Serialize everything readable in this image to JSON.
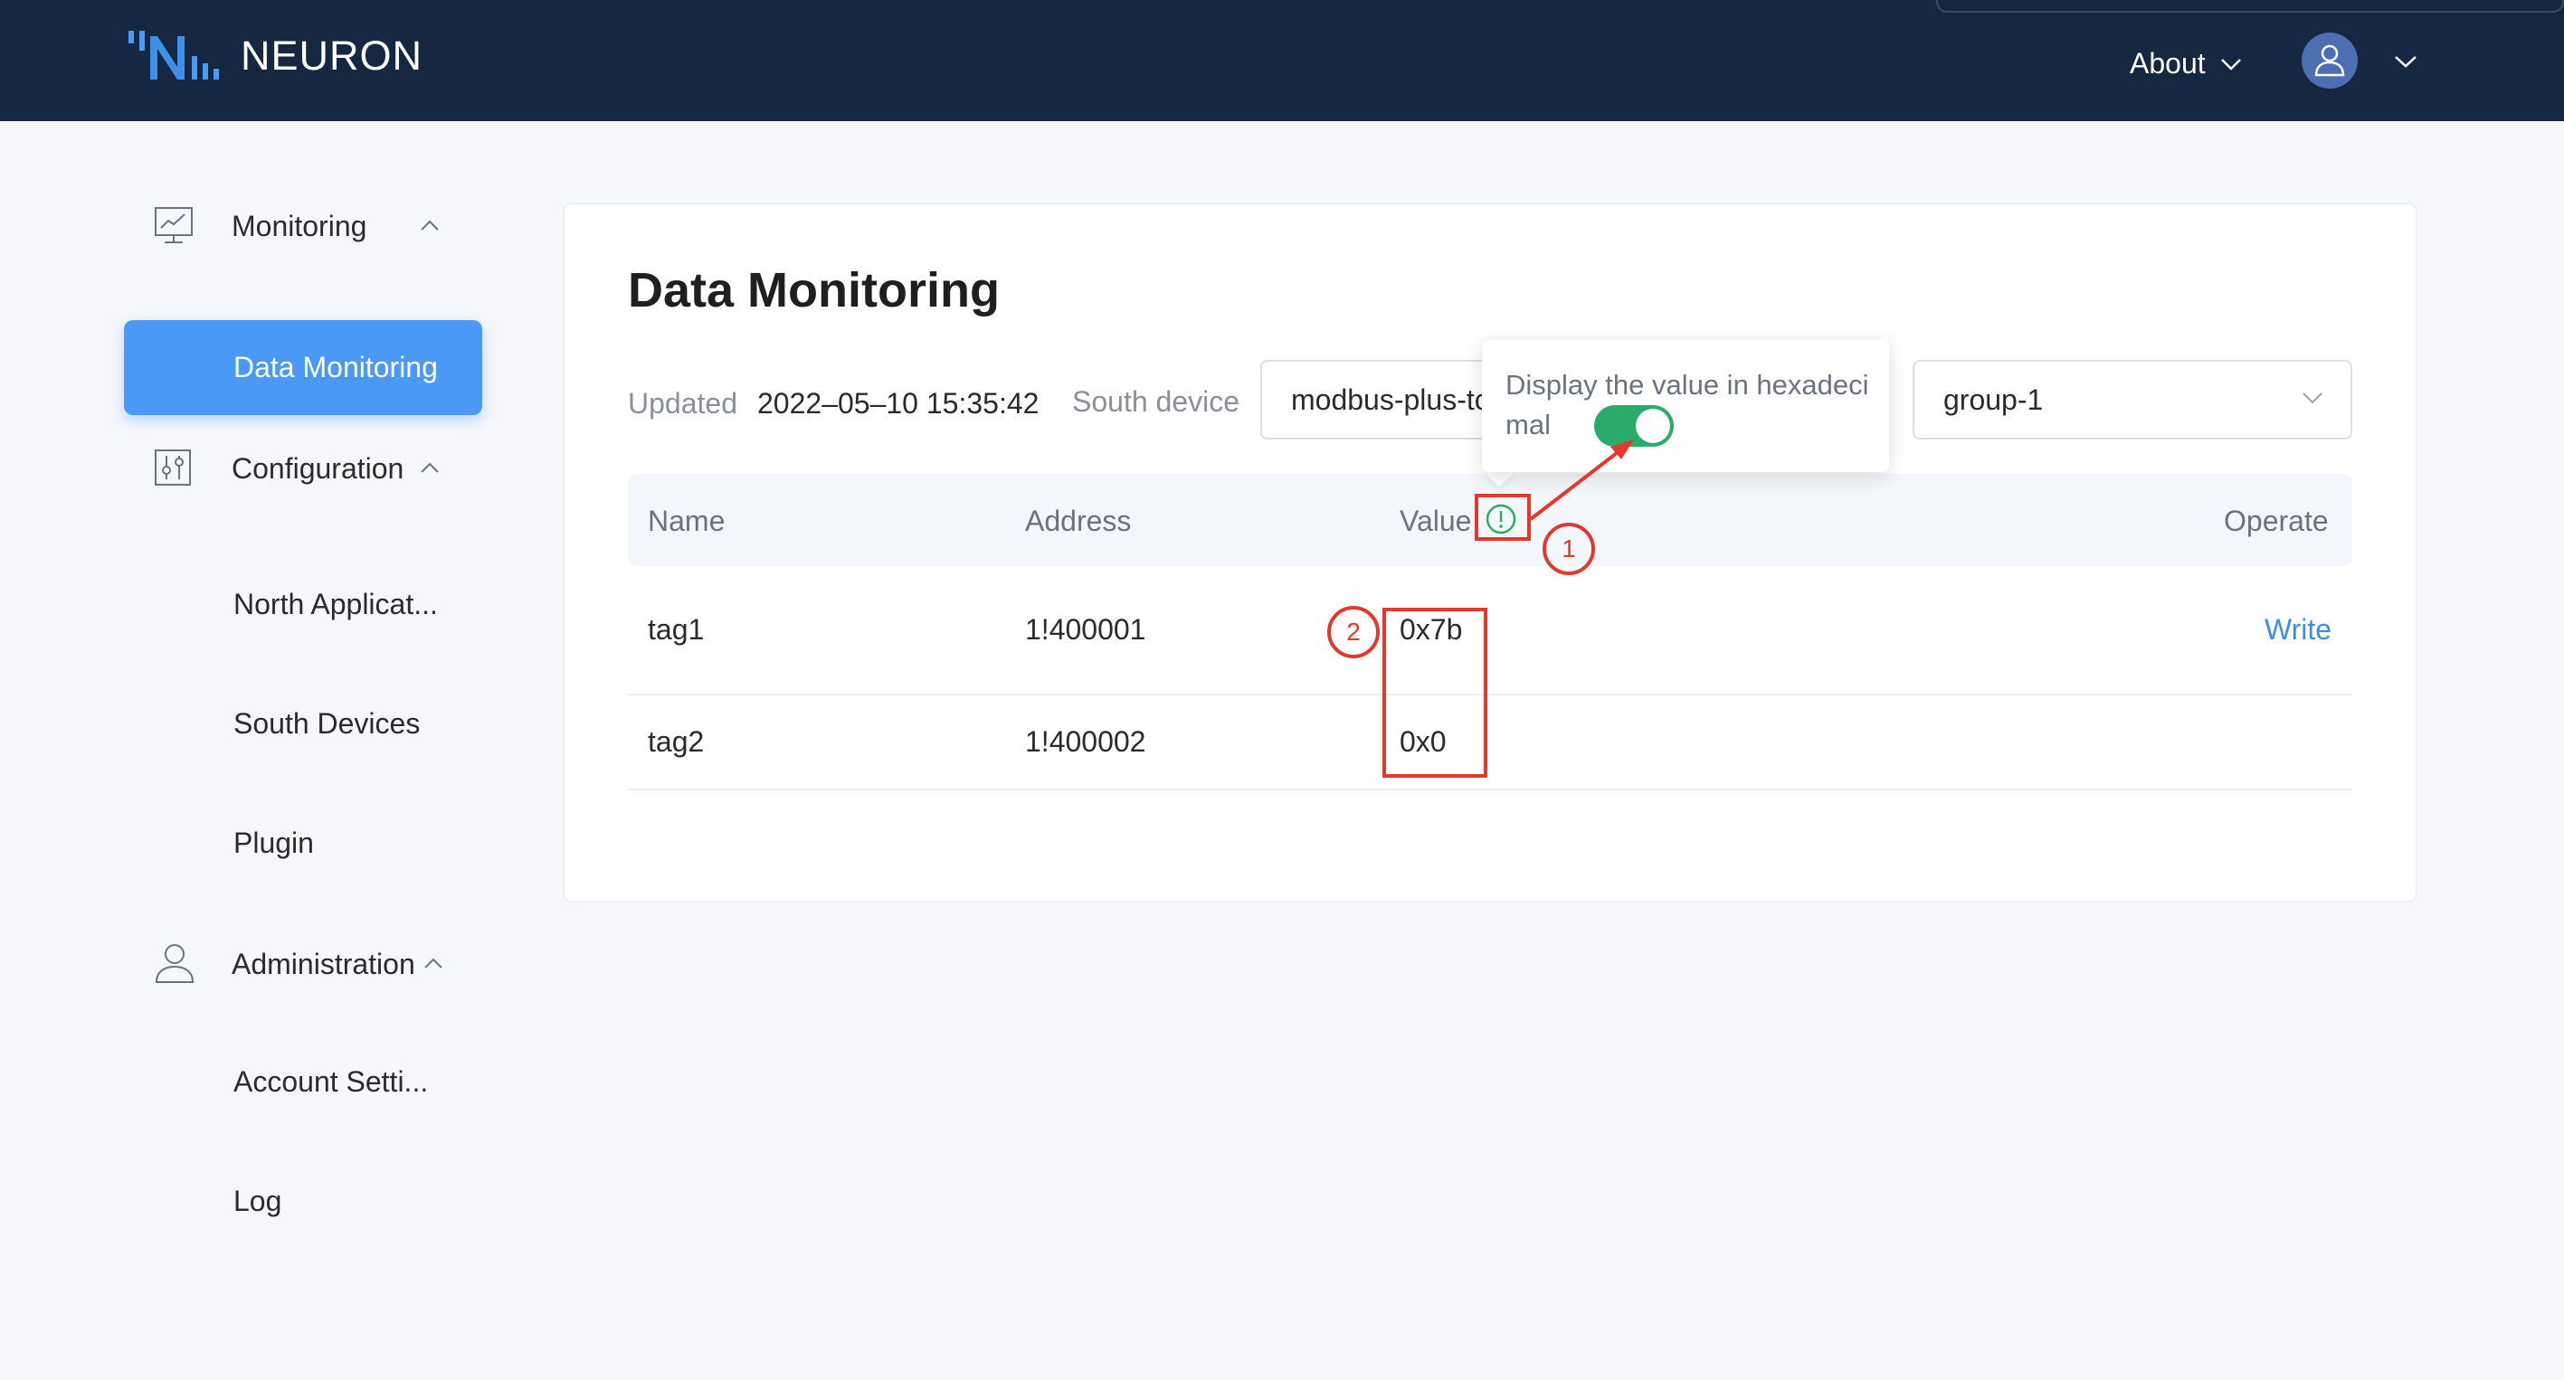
{
  "header": {
    "brand": "NEURON",
    "about_label": "About",
    "logo_icon": "neuron-logo-icon",
    "user_icon": "user-icon",
    "colors": {
      "background": "#162741",
      "text": "#ffffff"
    }
  },
  "sidebar": {
    "groups": [
      {
        "label": "Monitoring",
        "icon": "chart-monitor-icon",
        "expanded": true,
        "items": [
          {
            "label": "Data Monitoring",
            "active": true
          }
        ]
      },
      {
        "label": "Configuration",
        "icon": "sliders-icon",
        "expanded": true,
        "items": [
          {
            "label": "North Applicat..."
          },
          {
            "label": "South Devices"
          },
          {
            "label": "Plugin"
          }
        ]
      },
      {
        "label": "Administration",
        "icon": "user-icon",
        "expanded": true,
        "items": [
          {
            "label": "Account Setti..."
          },
          {
            "label": "Log"
          }
        ]
      }
    ],
    "active_color": "#4a9af5"
  },
  "main": {
    "title": "Data Monitoring",
    "updated_label": "Updated",
    "updated_value": "2022–05–10 15:35:42",
    "south_device_label": "South device",
    "south_device_value": "modbus-plus-tcp",
    "group_value": "group-1",
    "table": {
      "columns": [
        "Name",
        "Address",
        "Value",
        "Operate"
      ],
      "rows": [
        {
          "name": "tag1",
          "address": "1!400001",
          "value": "0x7b",
          "operate": "Write"
        },
        {
          "name": "tag2",
          "address": "1!400002",
          "value": "0x0",
          "operate": ""
        }
      ]
    },
    "tooltip": {
      "text": "Display the value in hexadecimal",
      "toggle_on": true,
      "toggle_color": "#2bab6a"
    },
    "link_color": "#3a8ee6"
  },
  "annotations": [
    {
      "label": "1",
      "color": "#e23a2a"
    },
    {
      "label": "2",
      "color": "#e23a2a"
    }
  ]
}
